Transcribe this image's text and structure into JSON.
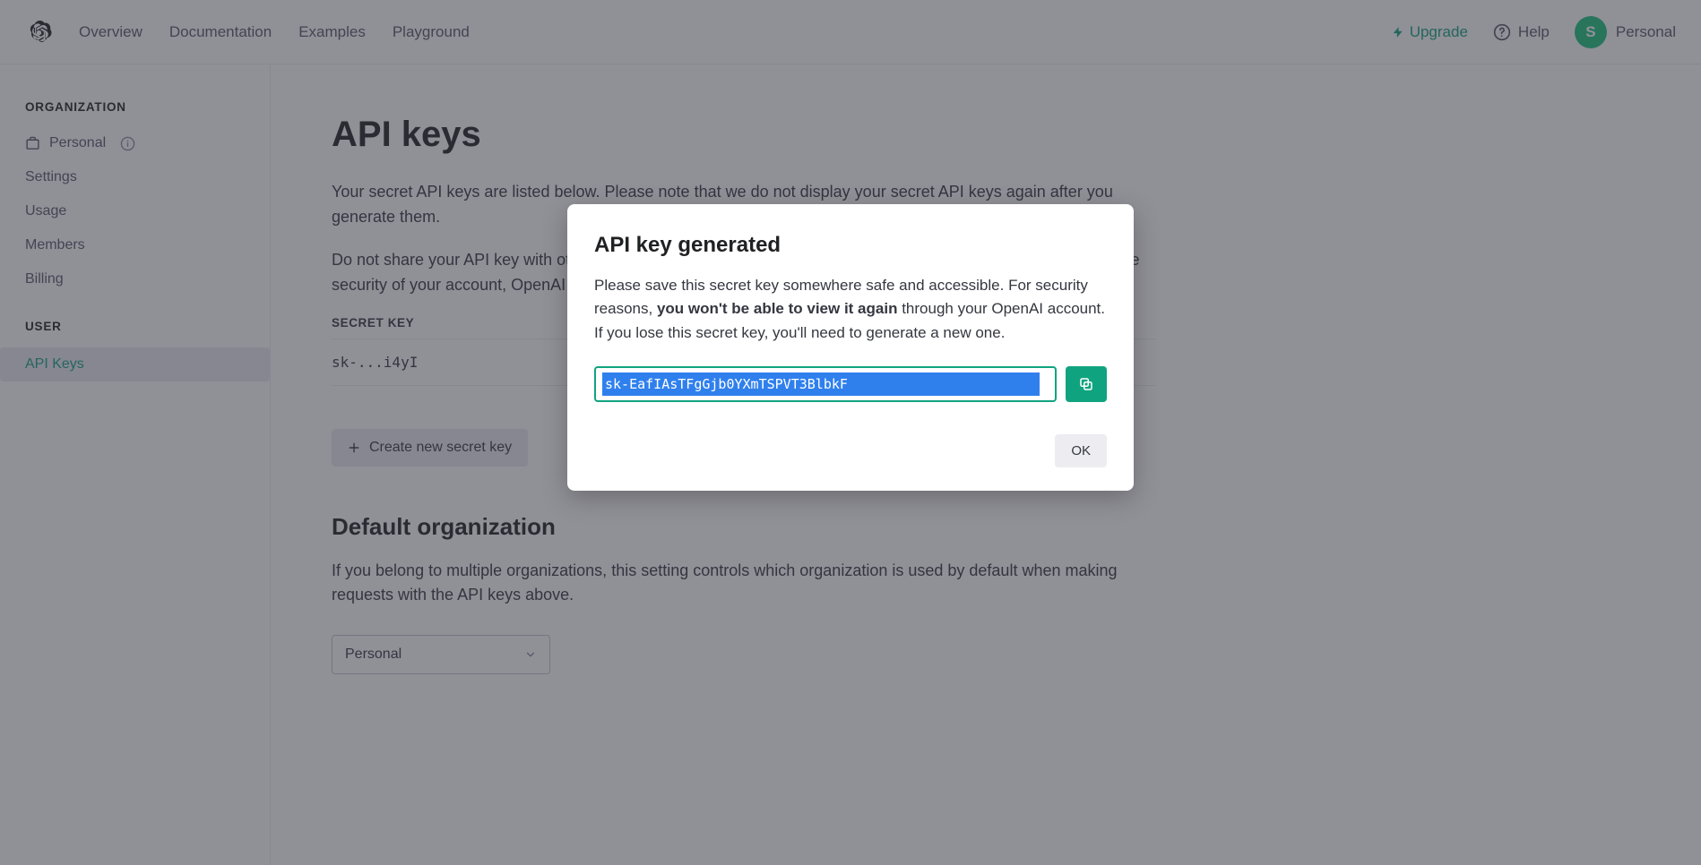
{
  "header": {
    "nav": [
      "Overview",
      "Documentation",
      "Examples",
      "Playground"
    ],
    "upgrade": "Upgrade",
    "help": "Help",
    "account_label": "Personal",
    "account_initial": "S"
  },
  "sidebar": {
    "org_title": "ORGANIZATION",
    "org_name": "Personal",
    "org_items": [
      "Settings",
      "Usage",
      "Members",
      "Billing"
    ],
    "user_title": "USER",
    "user_items": [
      "API Keys"
    ],
    "active": "API Keys"
  },
  "page": {
    "title": "API keys",
    "intro1": "Your secret API keys are listed below. Please note that we do not display your secret API keys again after you generate them.",
    "intro2": "Do not share your API key with others, or expose it in the browser or other client-side code. In order to protect the security of your account, OpenAI may also automatically rotate any API key that we've found has leaked publicly.",
    "table_header": "SECRET KEY",
    "row_key": "sk-...i4yI",
    "create_label": "Create new secret key",
    "default_org_title": "Default organization",
    "default_org_desc": "If you belong to multiple organizations, this setting controls which organization is used by default when making requests with the API keys above.",
    "org_select_value": "Personal"
  },
  "modal": {
    "title": "API key generated",
    "p1_a": "Please save this secret key somewhere safe and accessible. For security reasons, ",
    "p1_strong": "you won't be able to view it again",
    "p1_b": " through your OpenAI account. If you lose this secret key, you'll need to generate a new one.",
    "key_value": "sk-EafIAsTFgGjb0YXmTSPVT3BlbkF",
    "ok": "OK"
  }
}
